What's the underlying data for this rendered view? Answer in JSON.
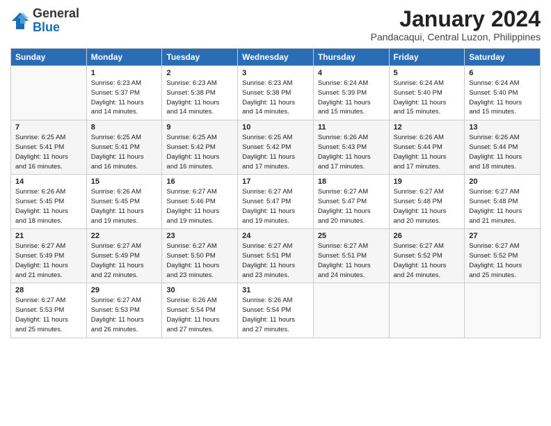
{
  "logo": {
    "general": "General",
    "blue": "Blue"
  },
  "title": "January 2024",
  "subtitle": "Pandacaqui, Central Luzon, Philippines",
  "days_of_week": [
    "Sunday",
    "Monday",
    "Tuesday",
    "Wednesday",
    "Thursday",
    "Friday",
    "Saturday"
  ],
  "weeks": [
    [
      {
        "day": "",
        "info": ""
      },
      {
        "day": "1",
        "info": "Sunrise: 6:23 AM\nSunset: 5:37 PM\nDaylight: 11 hours\nand 14 minutes."
      },
      {
        "day": "2",
        "info": "Sunrise: 6:23 AM\nSunset: 5:38 PM\nDaylight: 11 hours\nand 14 minutes."
      },
      {
        "day": "3",
        "info": "Sunrise: 6:23 AM\nSunset: 5:38 PM\nDaylight: 11 hours\nand 14 minutes."
      },
      {
        "day": "4",
        "info": "Sunrise: 6:24 AM\nSunset: 5:39 PM\nDaylight: 11 hours\nand 15 minutes."
      },
      {
        "day": "5",
        "info": "Sunrise: 6:24 AM\nSunset: 5:40 PM\nDaylight: 11 hours\nand 15 minutes."
      },
      {
        "day": "6",
        "info": "Sunrise: 6:24 AM\nSunset: 5:40 PM\nDaylight: 11 hours\nand 15 minutes."
      }
    ],
    [
      {
        "day": "7",
        "info": "Sunrise: 6:25 AM\nSunset: 5:41 PM\nDaylight: 11 hours\nand 16 minutes."
      },
      {
        "day": "8",
        "info": "Sunrise: 6:25 AM\nSunset: 5:41 PM\nDaylight: 11 hours\nand 16 minutes."
      },
      {
        "day": "9",
        "info": "Sunrise: 6:25 AM\nSunset: 5:42 PM\nDaylight: 11 hours\nand 16 minutes."
      },
      {
        "day": "10",
        "info": "Sunrise: 6:25 AM\nSunset: 5:42 PM\nDaylight: 11 hours\nand 17 minutes."
      },
      {
        "day": "11",
        "info": "Sunrise: 6:26 AM\nSunset: 5:43 PM\nDaylight: 11 hours\nand 17 minutes."
      },
      {
        "day": "12",
        "info": "Sunrise: 6:26 AM\nSunset: 5:44 PM\nDaylight: 11 hours\nand 17 minutes."
      },
      {
        "day": "13",
        "info": "Sunrise: 6:26 AM\nSunset: 5:44 PM\nDaylight: 11 hours\nand 18 minutes."
      }
    ],
    [
      {
        "day": "14",
        "info": "Sunrise: 6:26 AM\nSunset: 5:45 PM\nDaylight: 11 hours\nand 18 minutes."
      },
      {
        "day": "15",
        "info": "Sunrise: 6:26 AM\nSunset: 5:45 PM\nDaylight: 11 hours\nand 19 minutes."
      },
      {
        "day": "16",
        "info": "Sunrise: 6:27 AM\nSunset: 5:46 PM\nDaylight: 11 hours\nand 19 minutes."
      },
      {
        "day": "17",
        "info": "Sunrise: 6:27 AM\nSunset: 5:47 PM\nDaylight: 11 hours\nand 19 minutes."
      },
      {
        "day": "18",
        "info": "Sunrise: 6:27 AM\nSunset: 5:47 PM\nDaylight: 11 hours\nand 20 minutes."
      },
      {
        "day": "19",
        "info": "Sunrise: 6:27 AM\nSunset: 5:48 PM\nDaylight: 11 hours\nand 20 minutes."
      },
      {
        "day": "20",
        "info": "Sunrise: 6:27 AM\nSunset: 5:48 PM\nDaylight: 11 hours\nand 21 minutes."
      }
    ],
    [
      {
        "day": "21",
        "info": "Sunrise: 6:27 AM\nSunset: 5:49 PM\nDaylight: 11 hours\nand 21 minutes."
      },
      {
        "day": "22",
        "info": "Sunrise: 6:27 AM\nSunset: 5:49 PM\nDaylight: 11 hours\nand 22 minutes."
      },
      {
        "day": "23",
        "info": "Sunrise: 6:27 AM\nSunset: 5:50 PM\nDaylight: 11 hours\nand 23 minutes."
      },
      {
        "day": "24",
        "info": "Sunrise: 6:27 AM\nSunset: 5:51 PM\nDaylight: 11 hours\nand 23 minutes."
      },
      {
        "day": "25",
        "info": "Sunrise: 6:27 AM\nSunset: 5:51 PM\nDaylight: 11 hours\nand 24 minutes."
      },
      {
        "day": "26",
        "info": "Sunrise: 6:27 AM\nSunset: 5:52 PM\nDaylight: 11 hours\nand 24 minutes."
      },
      {
        "day": "27",
        "info": "Sunrise: 6:27 AM\nSunset: 5:52 PM\nDaylight: 11 hours\nand 25 minutes."
      }
    ],
    [
      {
        "day": "28",
        "info": "Sunrise: 6:27 AM\nSunset: 5:53 PM\nDaylight: 11 hours\nand 25 minutes."
      },
      {
        "day": "29",
        "info": "Sunrise: 6:27 AM\nSunset: 5:53 PM\nDaylight: 11 hours\nand 26 minutes."
      },
      {
        "day": "30",
        "info": "Sunrise: 6:26 AM\nSunset: 5:54 PM\nDaylight: 11 hours\nand 27 minutes."
      },
      {
        "day": "31",
        "info": "Sunrise: 6:26 AM\nSunset: 5:54 PM\nDaylight: 11 hours\nand 27 minutes."
      },
      {
        "day": "",
        "info": ""
      },
      {
        "day": "",
        "info": ""
      },
      {
        "day": "",
        "info": ""
      }
    ]
  ]
}
